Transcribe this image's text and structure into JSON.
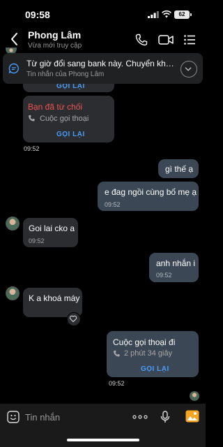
{
  "status_bar": {
    "time": "09:58",
    "battery": "62"
  },
  "header": {
    "name": "Phong Lâm",
    "status": "Vừa mới truy cập"
  },
  "pinned": {
    "text": "Từ giờ đổi sang bank này. Chuyển khoả...",
    "sub": "Tin nhắn của Phong Lâm"
  },
  "messages": {
    "partial_recall": "GỌI LẠI",
    "declined_call": {
      "title": "Bạn đã từ chối",
      "sub": "Cuộc gọi thoại",
      "action": "GỌI LẠI"
    },
    "time_1": "09:52",
    "out_1": {
      "text": "gì thế ạ"
    },
    "out_2": {
      "text": "e đag ngồi cùng bố mẹ ạ",
      "time": "09:52"
    },
    "in_1": {
      "text": "Goi lai cko a",
      "time": "09:52"
    },
    "out_3": {
      "text": "anh nhắn i",
      "time": "09:52"
    },
    "in_2": {
      "text": "K a khoá máy"
    },
    "voice_call": {
      "title": "Cuộc gọi thoại đi",
      "duration": "2 phút 34 giây",
      "action": "GỌI LẠI"
    },
    "time_2": "09:52"
  },
  "composer": {
    "placeholder": "Tin nhắn"
  },
  "colors": {
    "recall": "#4a9df8",
    "declined": "#ef5350",
    "outgoing_bubble": "#3b4754",
    "incoming_bubble": "#2b2d30",
    "image_button": "#f5a623"
  }
}
